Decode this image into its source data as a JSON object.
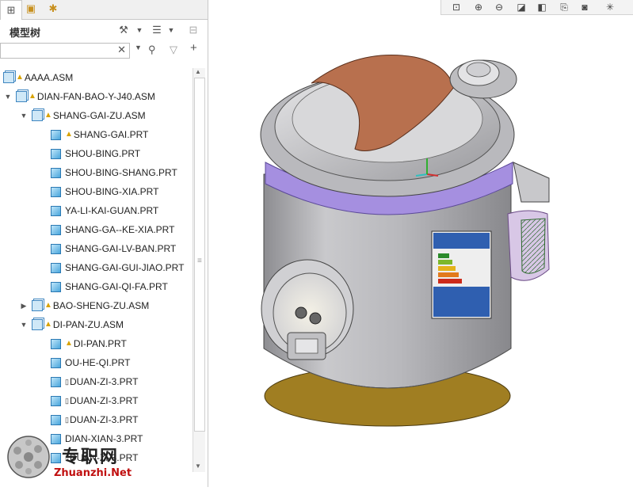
{
  "panel": {
    "title": "模型树"
  },
  "search": {
    "value": "",
    "placeholder": ""
  },
  "tree": [
    {
      "label": "AAAA.ASM",
      "kind": "asm",
      "warn": true
    },
    {
      "label": "DIAN-FAN-BAO-Y-J40.ASM",
      "kind": "asm",
      "warn": true,
      "expander": "▼"
    },
    {
      "label": "SHANG-GAI-ZU.ASM",
      "kind": "asm",
      "warn": true,
      "expander": "▼"
    },
    {
      "label": "SHANG-GAI.PRT",
      "kind": "prt",
      "warn": true
    },
    {
      "label": "SHOU-BING.PRT",
      "kind": "prt"
    },
    {
      "label": "SHOU-BING-SHANG.PRT",
      "kind": "prt"
    },
    {
      "label": "SHOU-BING-XIA.PRT",
      "kind": "prt"
    },
    {
      "label": "YA-LI-KAI-GUAN.PRT",
      "kind": "prt"
    },
    {
      "label": "SHANG-GA--KE-XIA.PRT",
      "kind": "prt"
    },
    {
      "label": "SHANG-GAI-LV-BAN.PRT",
      "kind": "prt"
    },
    {
      "label": "SHANG-GAI-GUI-JIAO.PRT",
      "kind": "prt"
    },
    {
      "label": "SHANG-GAI-QI-FA.PRT",
      "kind": "prt"
    },
    {
      "label": "BAO-SHENG-ZU.ASM",
      "kind": "asm",
      "warn": true,
      "expander": "▶"
    },
    {
      "label": "DI-PAN-ZU.ASM",
      "kind": "asm",
      "warn": true,
      "expander": "▼"
    },
    {
      "label": "DI-PAN.PRT",
      "kind": "prt",
      "warn": true
    },
    {
      "label": "OU-HE-QI.PRT",
      "kind": "prt"
    },
    {
      "label": "DUAN-ZI-3.PRT",
      "kind": "prt",
      "note": true
    },
    {
      "label": "DUAN-ZI-3.PRT",
      "kind": "prt",
      "note": true
    },
    {
      "label": "DUAN-ZI-3.PRT",
      "kind": "prt",
      "note": true
    },
    {
      "label": "DIAN-XIAN-3.PRT",
      "kind": "prt"
    },
    {
      "label": "DUAN-ZI-3.PRT",
      "kind": "prt",
      "note": true
    }
  ],
  "icons": {
    "tab1": "model-tree-icon",
    "tab2": "layers-icon",
    "tab3": "favorites-icon",
    "settings": "tools-icon",
    "show": "list-options-icon",
    "tree_cols": "columns-icon",
    "find": "binoculars-icon",
    "filter": "filter-icon",
    "add": "plus-icon"
  },
  "watermark": {
    "cn": "专职网",
    "en": "Zhuanzhi.Net"
  },
  "colors": {
    "lid_accent": "#b8704e",
    "body": "#b4b4b8",
    "trim": "#9c82d6",
    "base": "#b08a2a"
  }
}
